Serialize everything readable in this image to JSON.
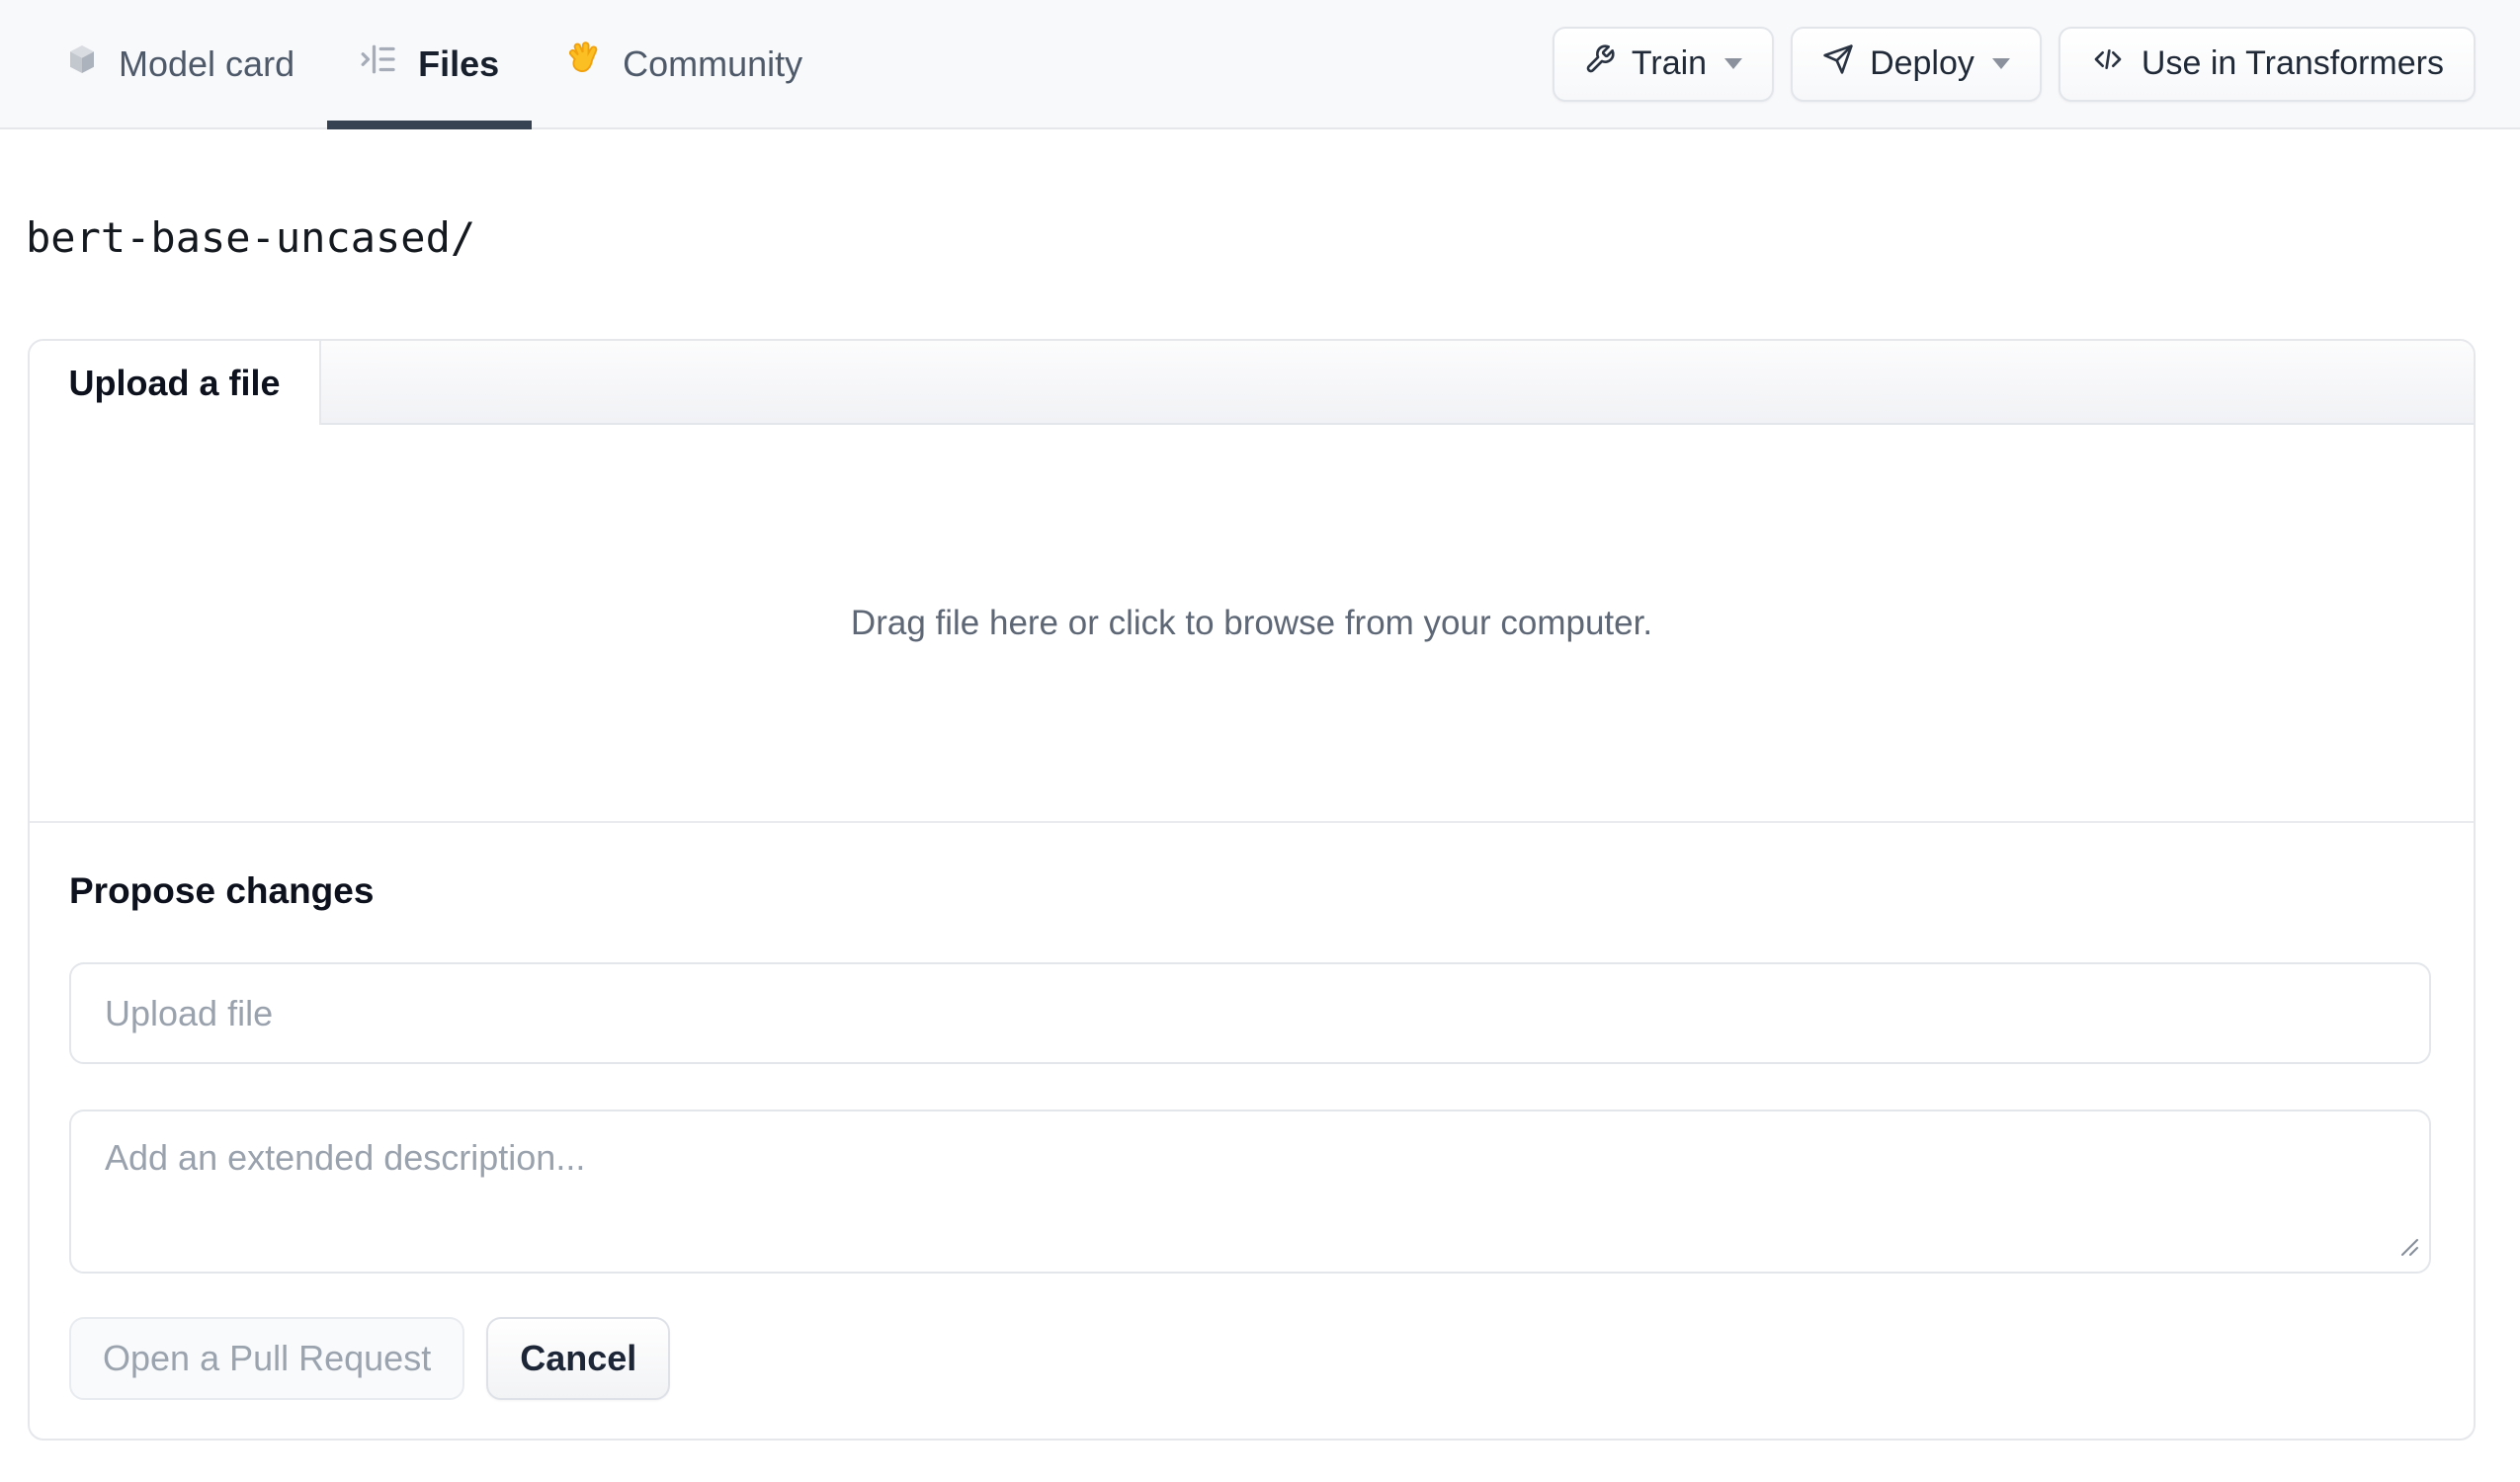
{
  "nav": {
    "tabs": [
      {
        "label": "Model card",
        "icon": "cube-icon",
        "active": false
      },
      {
        "label": "Files",
        "icon": "file-tree-icon",
        "active": true
      },
      {
        "label": "Community",
        "icon": "waving-hand-icon",
        "active": false
      }
    ],
    "actions": [
      {
        "label": "Train",
        "icon": "wrench-icon",
        "has_dropdown": true
      },
      {
        "label": "Deploy",
        "icon": "rocket-icon",
        "has_dropdown": true
      },
      {
        "label": "Use in Transformers",
        "icon": "code-icon",
        "has_dropdown": false
      }
    ]
  },
  "breadcrumb": {
    "path": "bert-base-uncased/"
  },
  "upload_card": {
    "tab_label": "Upload a file",
    "dropzone_text": "Drag file here or click to browse from your computer.",
    "propose": {
      "heading": "Propose changes",
      "filename_placeholder": "Upload file",
      "description_placeholder": "Add an extended description...",
      "submit_label": "Open a Pull Request",
      "cancel_label": "Cancel"
    }
  },
  "colors": {
    "nav_background": "#f8f9fb",
    "active_tab_underline": "#364152",
    "card_border": "#e5e7eb",
    "muted_text": "#5d6776",
    "placeholder_text": "#9aa2ae",
    "hand_emoji_fill": "#fbbf24"
  }
}
